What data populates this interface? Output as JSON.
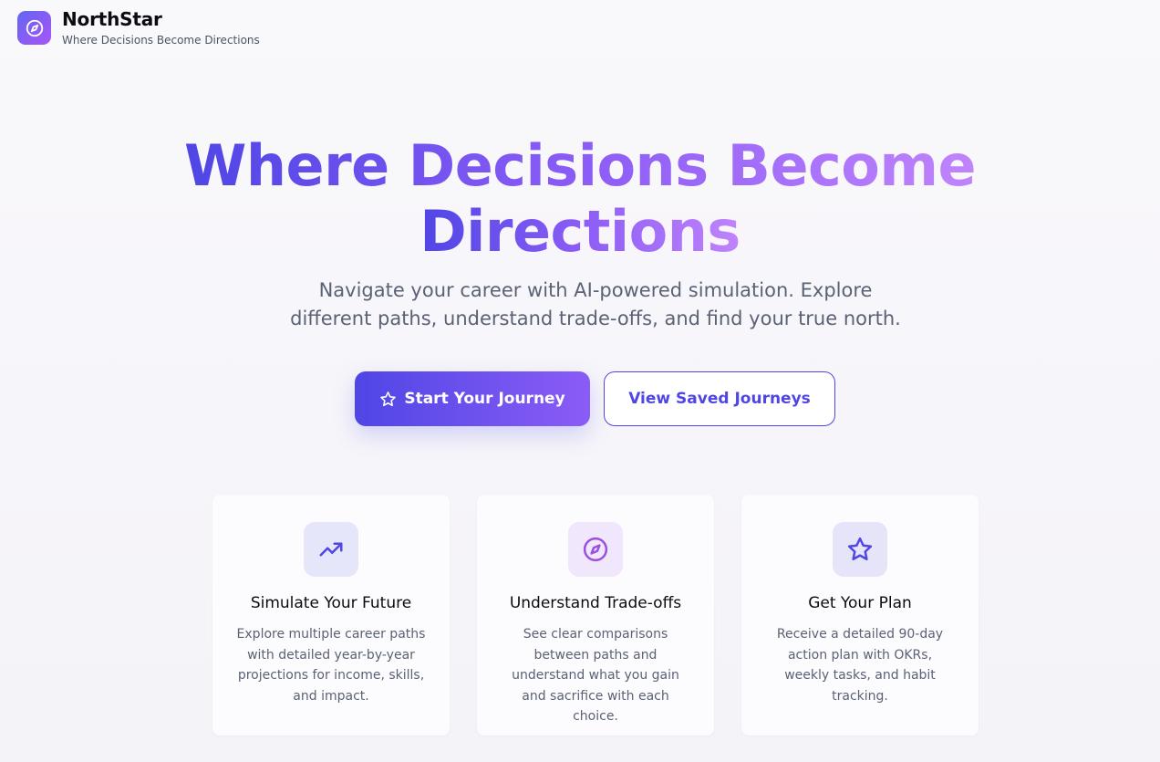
{
  "app": {
    "name": "NorthStar",
    "tagline": "Where Decisions Become Directions",
    "logo_icon": "compass-icon"
  },
  "hero": {
    "title_part1": "Where Decisions Become",
    "title_part2": "Directions",
    "subtitle": "Navigate your career with AI-powered simulation. Explore different paths, understand trade-offs, and find your true north.",
    "primary_button": {
      "label": "Start Your Journey",
      "icon": "star-icon"
    },
    "secondary_button": {
      "label": "View Saved Journeys"
    }
  },
  "features": [
    {
      "icon": "trending-up-icon",
      "title": "Simulate Your Future",
      "description": "Explore multiple career paths with detailed year-by-year projections for income, skills, and impact."
    },
    {
      "icon": "compass-icon",
      "title": "Understand Trade-offs",
      "description": "See clear comparisons between paths and understand what you gain and sacrifice with each choice."
    },
    {
      "icon": "star-icon",
      "title": "Get Your Plan",
      "description": "Receive a detailed 90-day action plan with OKRs, weekly tasks, and habit tracking."
    }
  ],
  "colors": {
    "primary": "#4f46e5",
    "accent": "#a855f7",
    "text_muted": "#5b6275"
  }
}
